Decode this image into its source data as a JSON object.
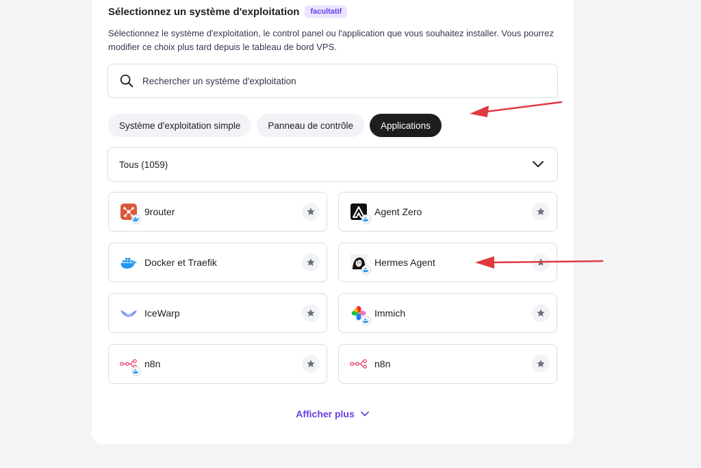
{
  "section": {
    "title": "Sélectionnez un système d'exploitation",
    "badge": "facultatif",
    "description": "Sélectionnez le système d'exploitation, le control panel ou l'application que vous souhaitez installer. Vous pourrez modifier ce choix plus tard depuis le tableau de bord VPS."
  },
  "search": {
    "placeholder": "Rechercher un système d'exploitation"
  },
  "tabs": [
    {
      "label": "Système d'exploitation simple"
    },
    {
      "label": "Panneau de contrôle"
    },
    {
      "label": "Applications"
    }
  ],
  "active_tab": "Applications",
  "filter": {
    "value": "Tous (1059)"
  },
  "apps": [
    {
      "name": "9router",
      "icon": "9router-icon",
      "docker": true
    },
    {
      "name": "Agent Zero",
      "icon": "agent-zero-icon",
      "docker": true
    },
    {
      "name": "Docker et Traefik",
      "icon": "docker-icon",
      "docker": false
    },
    {
      "name": "Hermes Agent",
      "icon": "hermes-icon",
      "docker": true
    },
    {
      "name": "IceWarp",
      "icon": "icewarp-icon",
      "docker": false
    },
    {
      "name": "Immich",
      "icon": "immich-icon",
      "docker": true
    },
    {
      "name": "n8n",
      "icon": "n8n-icon",
      "docker": true
    },
    {
      "name": "n8n",
      "icon": "n8n-icon",
      "docker": false
    }
  ],
  "show_more": {
    "label": "Afficher plus"
  },
  "colors": {
    "accent": "#673de6",
    "annotation": "#e0393e",
    "dark": "#1d1e20"
  }
}
